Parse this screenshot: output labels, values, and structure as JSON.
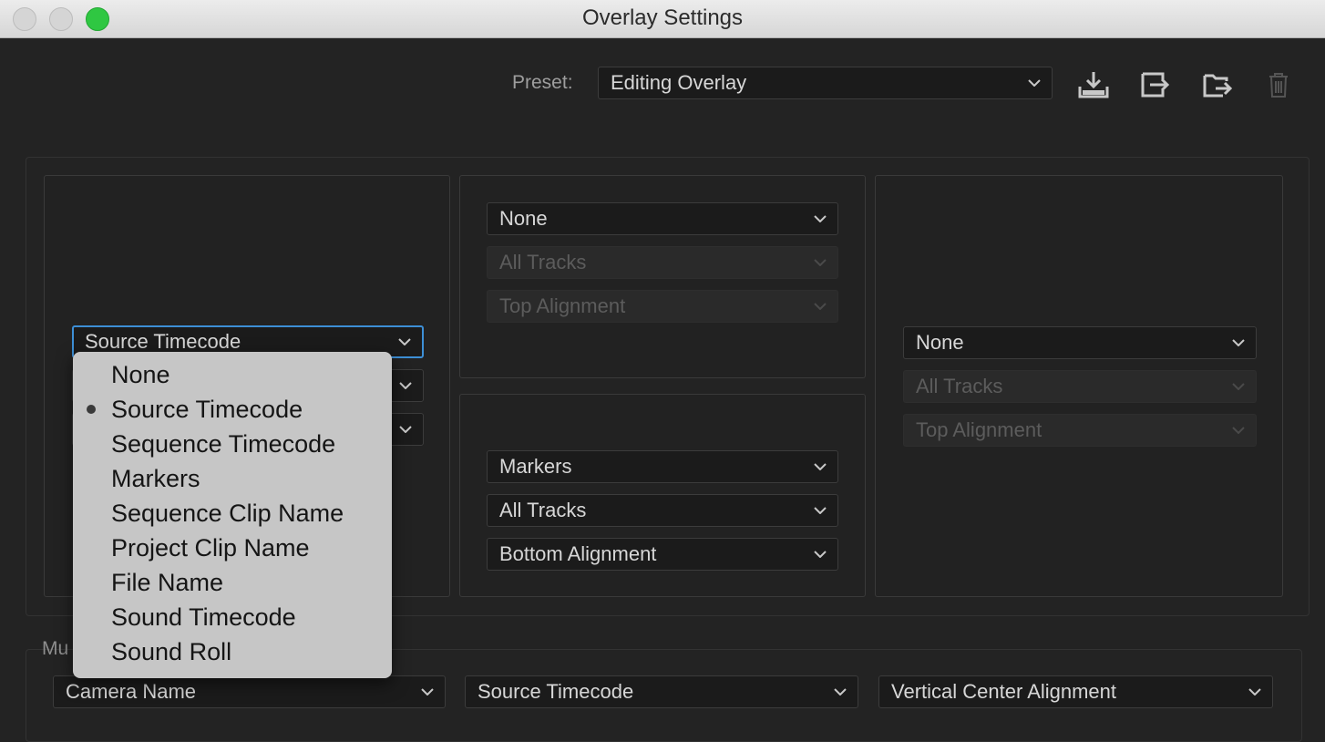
{
  "window": {
    "title": "Overlay Settings"
  },
  "preset": {
    "label": "Preset:",
    "value": "Editing Overlay"
  },
  "toolbar": {
    "icons": [
      "save-preset-icon",
      "import-preset-icon",
      "export-preset-icon",
      "delete-preset-icon"
    ]
  },
  "left_panel": {
    "field": "Source Timecode"
  },
  "top_center_panel": {
    "field": "None",
    "tracks": "All Tracks",
    "alignment": "Top Alignment"
  },
  "bottom_center_panel": {
    "field": "Markers",
    "tracks": "All Tracks",
    "alignment": "Bottom Alignment"
  },
  "right_panel": {
    "field": "None",
    "tracks": "All Tracks",
    "alignment": "Top Alignment"
  },
  "multicam": {
    "label_partial": "Mu",
    "camera": "Camera Name",
    "timecode": "Source Timecode",
    "alignment": "Vertical Center Alignment"
  },
  "dropdown_menu": {
    "selected": "Source Timecode",
    "items": [
      "None",
      "Source Timecode",
      "Sequence Timecode",
      "Markers",
      "Sequence Clip Name",
      "Project Clip Name",
      "File Name",
      "Sound Timecode",
      "Sound Roll"
    ]
  },
  "colors": {
    "focus": "#3d8fd6",
    "window_bg": "#232323",
    "traffic_green": "#2fc742"
  }
}
